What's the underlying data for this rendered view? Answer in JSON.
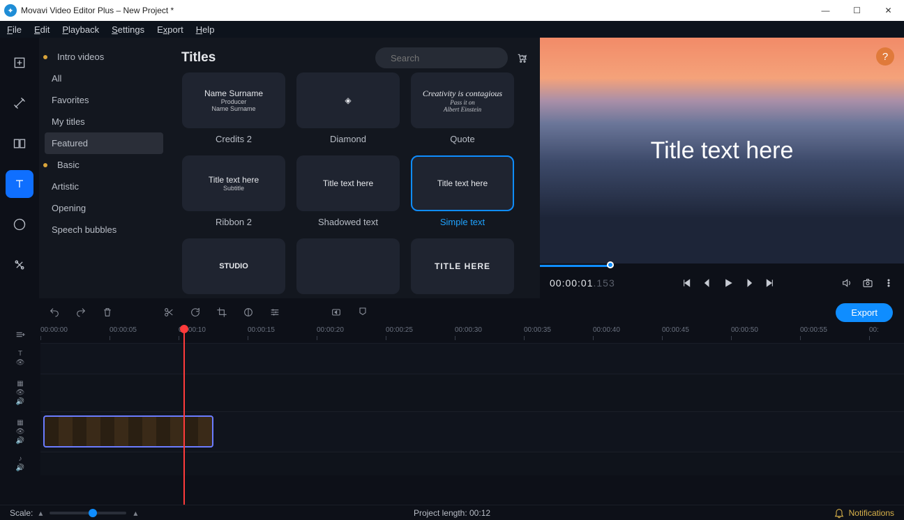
{
  "window": {
    "title": "Movavi Video Editor Plus – New Project *"
  },
  "menubar": [
    "File",
    "Edit",
    "Playback",
    "Settings",
    "Export",
    "Help"
  ],
  "sidebar": {
    "items": [
      {
        "label": "Intro videos",
        "dot": true
      },
      {
        "label": "All"
      },
      {
        "label": "Favorites"
      },
      {
        "label": "My titles"
      },
      {
        "label": "Featured",
        "active": true
      },
      {
        "label": "Basic",
        "dot": true
      },
      {
        "label": "Artistic"
      },
      {
        "label": "Opening"
      },
      {
        "label": "Speech bubbles"
      }
    ]
  },
  "browser": {
    "heading": "Titles",
    "search_placeholder": "Search",
    "titles": [
      {
        "label": "Credits 2",
        "preview_lines": [
          "Name Surname",
          "Producer",
          "Name Surname"
        ]
      },
      {
        "label": "Diamond",
        "preview_lines": [
          "◈"
        ]
      },
      {
        "label": "Quote",
        "preview_lines": [
          "Creativity is contagious",
          "Pass it on",
          "Albert Einstein"
        ]
      },
      {
        "label": "Ribbon 2",
        "preview_lines": [
          "Title text here",
          "Subtitle"
        ]
      },
      {
        "label": "Shadowed text",
        "preview_lines": [
          "Title text here"
        ]
      },
      {
        "label": "Simple text",
        "preview_lines": [
          "Title text here"
        ],
        "selected": true
      },
      {
        "label": "",
        "preview_lines": [
          "STUDIO"
        ]
      },
      {
        "label": "",
        "preview_lines": [
          ""
        ]
      },
      {
        "label": "",
        "preview_lines": [
          "TITLE HERE"
        ]
      }
    ]
  },
  "preview": {
    "overlay_text": "Title text here",
    "time_main": "00:00:01",
    "time_ms": ".153"
  },
  "timeline": {
    "export_label": "Export",
    "ruler": [
      "00:00:00",
      "00:00:05",
      "00:00:10",
      "00:00:15",
      "00:00:20",
      "00:00:25",
      "00:00:30",
      "00:00:35",
      "00:00:40",
      "00:00:45",
      "00:00:50",
      "00:00:55",
      "00:"
    ]
  },
  "status": {
    "scale_label": "Scale:",
    "project_length": "Project length:  00:12",
    "notifications": "Notifications"
  }
}
